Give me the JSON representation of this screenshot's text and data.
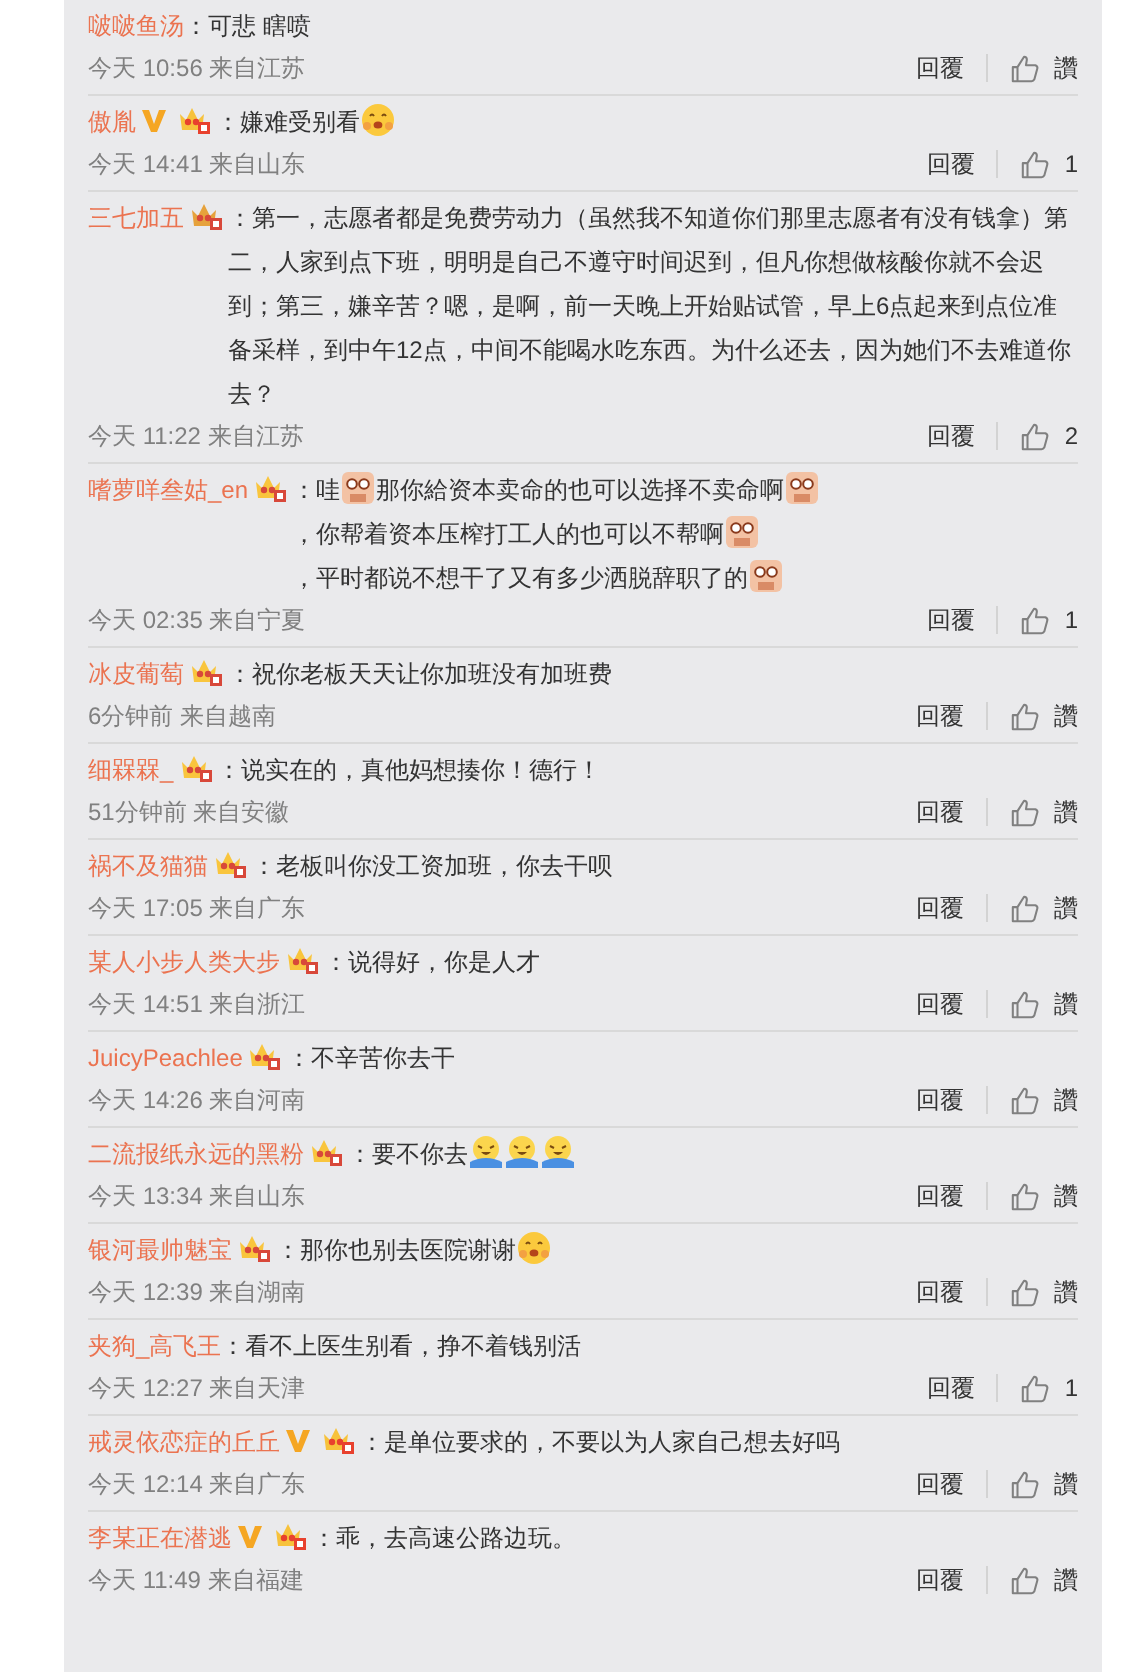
{
  "comments": [
    {
      "user": "啵啵鱼汤",
      "parts": [
        {
          "kind": "text",
          "text": "：可悲 瞎喷"
        }
      ],
      "meta": "今天 10:56 来自江苏",
      "reply": "回覆",
      "like": "讚"
    },
    {
      "user": "傲胤",
      "badges": [
        {
          "kind": "verified"
        },
        {
          "kind": "member-red"
        }
      ],
      "parts": [
        {
          "kind": "text",
          "text": "：嫌难受别看"
        },
        {
          "kind": "shy"
        }
      ],
      "meta": "今天 14:41 来自山东",
      "reply": "回覆",
      "like": "1"
    },
    {
      "user": "三七加五",
      "badges": [
        {
          "kind": "member-gold"
        }
      ],
      "parts": [
        {
          "kind": "text",
          "text": "：第一，志愿者都是免费劳动力（虽然我不知道你们那里志愿者有没有钱拿）第二，人家到点下班，明明是自己不遵守时间迟到，但凡你想做核酸你就不会迟到；第三，嫌辛苦？嗯，是啊，前一天晚上开始贴试管，早上6点起来到点位准备采样，到中午12点，中间不能喝水吃东西。为什么还去，因为她们不去难道你去？"
        }
      ],
      "meta": "今天 11:22 来自江苏",
      "reply": "回覆",
      "like": "2"
    },
    {
      "user": "嗜萝咩叁姑_en",
      "badges": [
        {
          "kind": "member"
        }
      ],
      "parts": [
        {
          "kind": "text",
          "text": "：哇"
        },
        {
          "kind": "fist"
        },
        {
          "kind": "text",
          "text": "那你給资本卖命的也可以选择不卖命啊"
        },
        {
          "kind": "fist"
        },
        {
          "kind": "text",
          "text": "，你帮着资本压榨打工人的也可以不帮啊"
        },
        {
          "kind": "fist"
        },
        {
          "kind": "text",
          "text": "，平时都说不想干了又有多少洒脱辞职了的"
        },
        {
          "kind": "fist"
        }
      ],
      "meta": "今天 02:35 来自宁夏",
      "reply": "回覆",
      "like": "1"
    },
    {
      "user": "冰皮葡萄",
      "badges": [
        {
          "kind": "member"
        }
      ],
      "parts": [
        {
          "kind": "text",
          "text": "：祝你老板天天让你加班没有加班费"
        }
      ],
      "meta": "6分钟前 来自越南",
      "reply": "回覆",
      "like": "讚"
    },
    {
      "user": "细槑槑_",
      "badges": [
        {
          "kind": "member"
        }
      ],
      "parts": [
        {
          "kind": "text",
          "text": "：说实在的，真他妈想揍你！德行！"
        }
      ],
      "meta": "51分钟前 来自安徽",
      "reply": "回覆",
      "like": "讚"
    },
    {
      "user": "祸不及猫猫",
      "badges": [
        {
          "kind": "member"
        }
      ],
      "parts": [
        {
          "kind": "text",
          "text": "：老板叫你没工资加班，你去干呗"
        }
      ],
      "meta": "今天 17:05 来自广东",
      "reply": "回覆",
      "like": "讚"
    },
    {
      "user": "某人小步人类大步",
      "badges": [
        {
          "kind": "member"
        }
      ],
      "parts": [
        {
          "kind": "text",
          "text": "：说得好，你是人才"
        }
      ],
      "meta": "今天 14:51 来自浙江",
      "reply": "回覆",
      "like": "讚"
    },
    {
      "user": "JuicyPeachlee",
      "badges": [
        {
          "kind": "member"
        }
      ],
      "parts": [
        {
          "kind": "text",
          "text": "：不辛苦你去干"
        }
      ],
      "meta": "今天 14:26 来自河南",
      "reply": "回覆",
      "like": "讚"
    },
    {
      "user": "二流报纸永远的黑粉",
      "badges": [
        {
          "kind": "member"
        }
      ],
      "parts": [
        {
          "kind": "text",
          "text": "：要不你去"
        },
        {
          "kind": "laugh"
        },
        {
          "kind": "laugh"
        },
        {
          "kind": "laugh"
        }
      ],
      "meta": "今天 13:34 来自山东",
      "reply": "回覆",
      "like": "讚"
    },
    {
      "user": "银河最帅魅宝",
      "badges": [
        {
          "kind": "member"
        }
      ],
      "parts": [
        {
          "kind": "text",
          "text": "：那你也别去医院谢谢"
        },
        {
          "kind": "shy"
        }
      ],
      "meta": "今天 12:39 来自湖南",
      "reply": "回覆",
      "like": "讚"
    },
    {
      "user": "夹狗_高飞王",
      "parts": [
        {
          "kind": "text",
          "text": "：看不上医生别看，挣不着钱别活"
        }
      ],
      "meta": "今天 12:27 来自天津",
      "reply": "回覆",
      "like": "1"
    },
    {
      "user": "戒灵依恋症的丘丘",
      "badges": [
        {
          "kind": "verified"
        },
        {
          "kind": "member-red"
        }
      ],
      "parts": [
        {
          "kind": "text",
          "text": "：是单位要求的，不要以为人家自己想去好吗"
        }
      ],
      "meta": "今天 12:14 来自广东",
      "reply": "回覆",
      "like": "讚"
    },
    {
      "user": "李某正在潜逃",
      "badges": [
        {
          "kind": "verified"
        },
        {
          "kind": "member-red"
        }
      ],
      "parts": [
        {
          "kind": "text",
          "text": "：乖，去高速公路边玩。"
        }
      ],
      "meta": "今天 11:49 来自福建",
      "reply": "回覆",
      "like": "讚"
    }
  ]
}
